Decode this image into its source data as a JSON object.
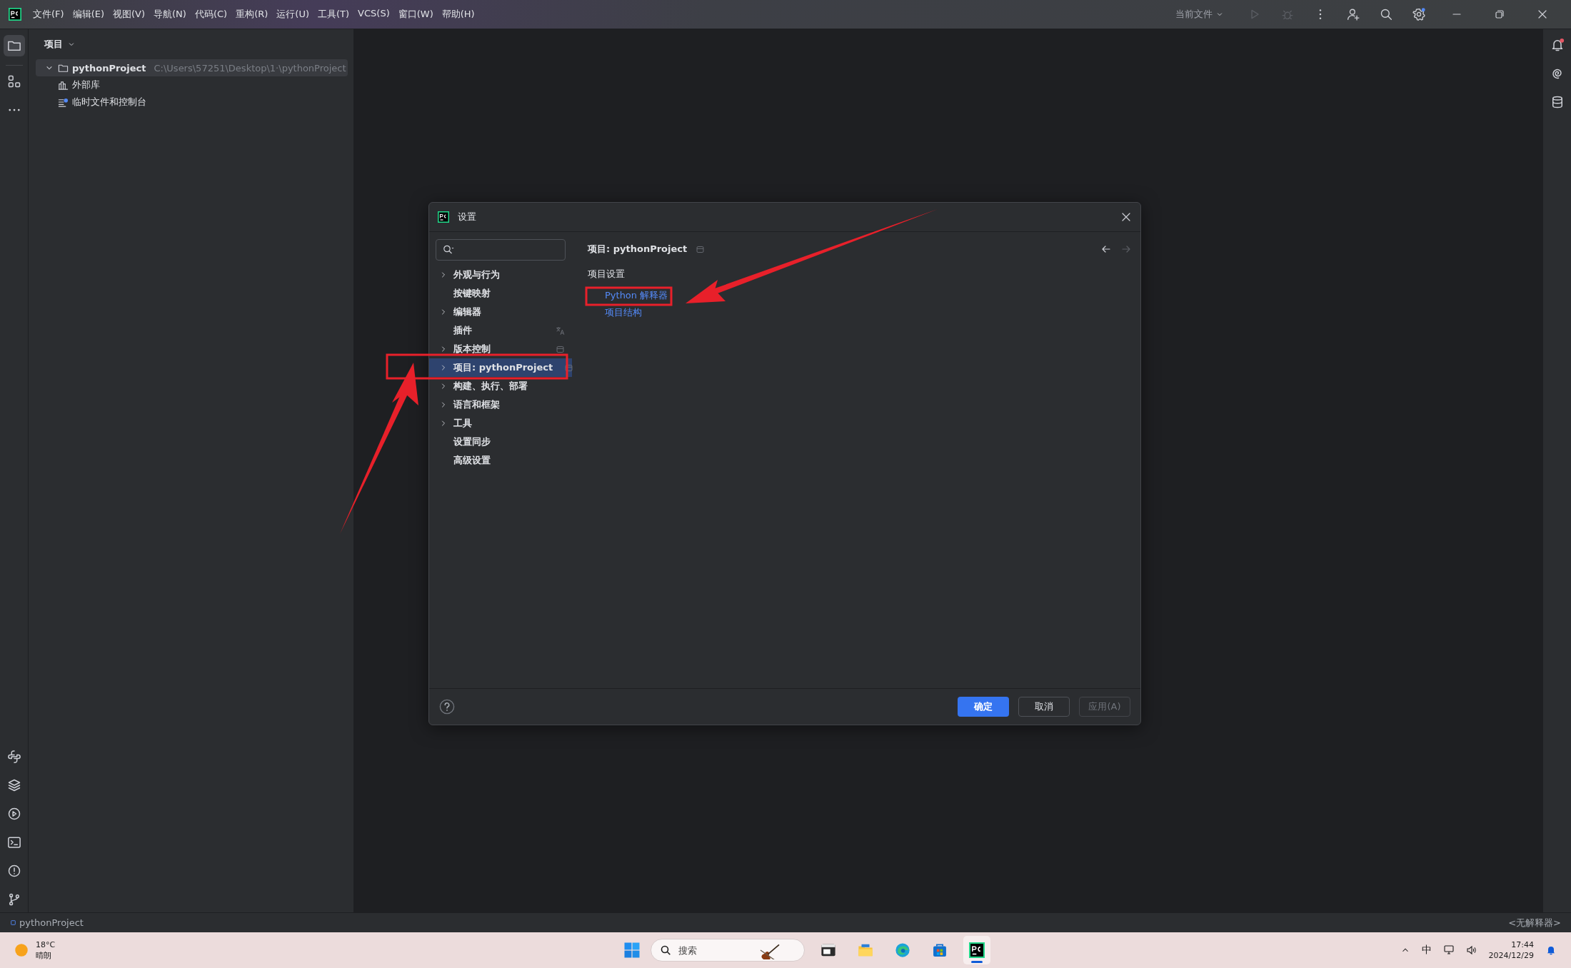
{
  "title_bar": {
    "menus": [
      "文件(F)",
      "编辑(E)",
      "视图(V)",
      "导航(N)",
      "代码(C)",
      "重构(R)",
      "运行(U)",
      "工具(T)",
      "VCS(S)",
      "窗口(W)",
      "帮助(H)"
    ],
    "run_config": "当前文件"
  },
  "tool_window": {
    "title": "项目",
    "tree": [
      {
        "label": "pythonProject",
        "path": "C:\\Users\\57251\\Desktop\\1·\\pythonProject",
        "kind": "folder",
        "expanded": true,
        "selected": true
      },
      {
        "label": "外部库",
        "kind": "library",
        "selected": false
      },
      {
        "label": "临时文件和控制台",
        "kind": "scratch",
        "selected": false
      }
    ]
  },
  "dialog": {
    "title": "设置",
    "nav": [
      {
        "label": "外观与行为",
        "expandable": true,
        "selected": false,
        "kind": "plain"
      },
      {
        "label": "按键映射",
        "expandable": false,
        "selected": false,
        "kind": "plain"
      },
      {
        "label": "编辑器",
        "expandable": true,
        "selected": false,
        "kind": "plain"
      },
      {
        "label": "插件",
        "expandable": false,
        "selected": false,
        "kind": "translatable"
      },
      {
        "label": "版本控制",
        "expandable": true,
        "selected": false,
        "kind": "scoped"
      },
      {
        "label": "项目: pythonProject",
        "expandable": true,
        "selected": true,
        "kind": "scoped"
      },
      {
        "label": "构建、执行、部署",
        "expandable": true,
        "selected": false,
        "kind": "plain"
      },
      {
        "label": "语言和框架",
        "expandable": true,
        "selected": false,
        "kind": "plain"
      },
      {
        "label": "工具",
        "expandable": true,
        "selected": false,
        "kind": "plain"
      },
      {
        "label": "设置同步",
        "expandable": false,
        "selected": false,
        "kind": "plain"
      },
      {
        "label": "高级设置",
        "expandable": false,
        "selected": false,
        "kind": "plain"
      }
    ],
    "page": {
      "title": "项目: pythonProject",
      "section": "项目设置",
      "links": [
        "Python 解释器",
        "项目结构"
      ]
    },
    "buttons": [
      {
        "label": "确定",
        "kind": "primary"
      },
      {
        "label": "取消",
        "kind": "normal"
      },
      {
        "label": "应用(A)",
        "kind": "disabled"
      }
    ]
  },
  "status_bar": {
    "project": "pythonProject",
    "interpreter": "<无解释器>"
  },
  "taskbar": {
    "weather": {
      "temperature": "18°C",
      "condition": "晴朗"
    },
    "search": {
      "placeholder": "搜索"
    },
    "apps": [
      {
        "kind": "terminal",
        "active": false
      },
      {
        "kind": "files",
        "active": false
      },
      {
        "kind": "browser",
        "active": false
      },
      {
        "kind": "store",
        "active": false
      },
      {
        "kind": "ide",
        "active": true
      }
    ],
    "ime": "中",
    "time": "17:44",
    "date": "2024/12/29"
  }
}
